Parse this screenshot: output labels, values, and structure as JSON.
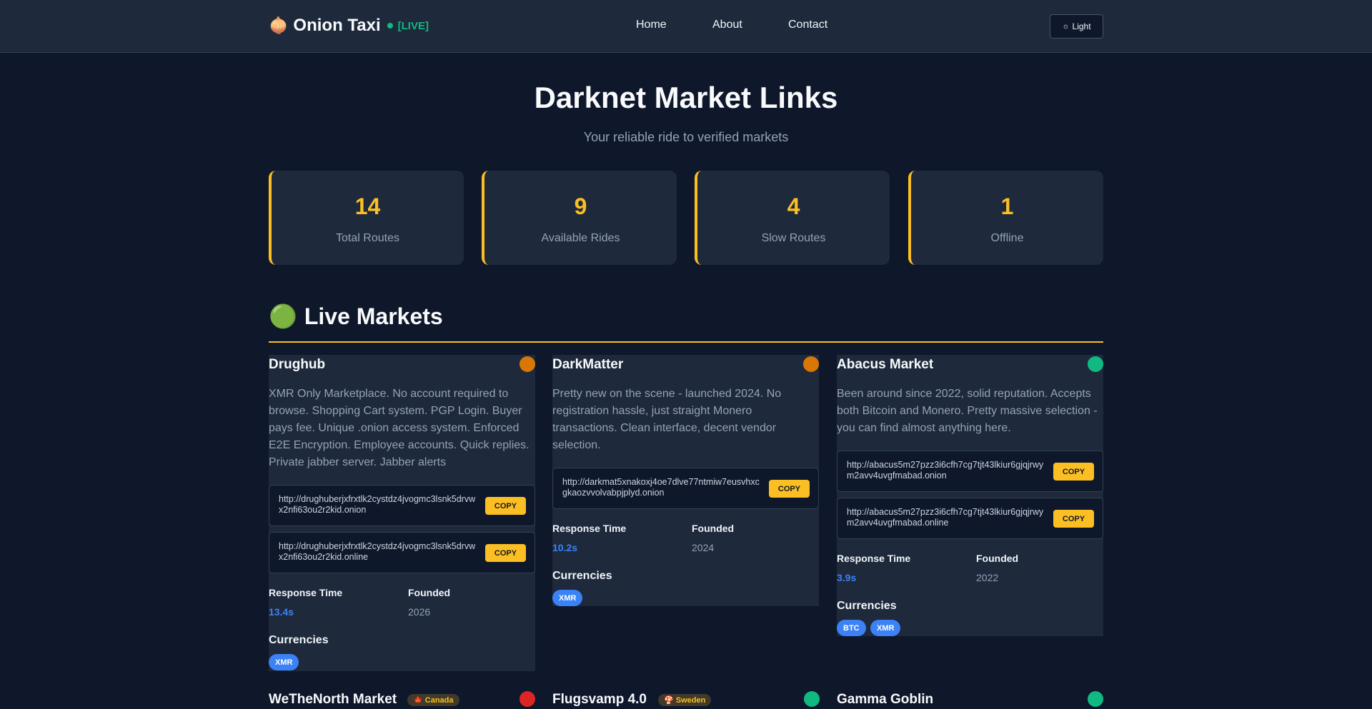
{
  "nav": {
    "brand_icon": "🧅",
    "brand_name": "Onion Taxi",
    "live_text": "[LIVE]",
    "links": [
      "Home",
      "About",
      "Contact"
    ],
    "theme_icon": "☼",
    "theme_label": "Light"
  },
  "hero": {
    "title": "Darknet Market Links",
    "subtitle": "Your reliable ride to verified markets"
  },
  "stats": [
    {
      "value": "14",
      "label": "Total Routes"
    },
    {
      "value": "9",
      "label": "Available Rides"
    },
    {
      "value": "4",
      "label": "Slow Routes"
    },
    {
      "value": "1",
      "label": "Offline"
    }
  ],
  "section": {
    "icon": "🟢",
    "title": "Live Markets"
  },
  "labels": {
    "copy": "COPY",
    "response_time": "Response Time",
    "founded": "Founded",
    "currencies": "Currencies"
  },
  "colors": {
    "accent": "#fbbf24",
    "status_slow": "#d97706",
    "status_online": "#10b981",
    "status_offline": "#dc2626",
    "link": "#3b82f6"
  },
  "markets": [
    {
      "name": "Drughub",
      "status": "slow",
      "description": "XMR Only Marketplace. No account required to browse. Shopping Cart system. PGP Login. Buyer pays fee. Unique .onion access system. Enforced E2E Encryption. Employee accounts. Quick replies. Private jabber server. Jabber alerts",
      "links": [
        "http://drughuberjxfrxtlk2cystdz4jvogmc3lsnk5drvwx2nfi63ou2r2kid.onion",
        "http://drughuberjxfrxtlk2cystdz4jvogmc3lsnk5drvwx2nfi63ou2r2kid.online"
      ],
      "response_time": "13.4s",
      "founded": "2026",
      "currencies": [
        "XMR"
      ]
    },
    {
      "name": "DarkMatter",
      "status": "slow",
      "description": "Pretty new on the scene - launched 2024. No registration hassle, just straight Monero transactions. Clean interface, decent vendor selection.",
      "links": [
        "http://darkmat5xnakoxj4oe7dlve77ntmiw7eusvhxcgkaozvvolvabpjplyd.onion"
      ],
      "response_time": "10.2s",
      "founded": "2024",
      "currencies": [
        "XMR"
      ]
    },
    {
      "name": "Abacus Market",
      "status": "online",
      "description": "Been around since 2022, solid reputation. Accepts both Bitcoin and Monero. Pretty massive selection - you can find almost anything here.",
      "links": [
        "http://abacus5m27pzz3i6cfh7cg7tjt43lkiur6gjqjrwym2avv4uvgfmabad.onion",
        "http://abacus5m27pzz3i6cfh7cg7tjt43lkiur6gjqjrwym2avv4uvgfmabad.online"
      ],
      "response_time": "3.9s",
      "founded": "2022",
      "currencies": [
        "BTC",
        "XMR"
      ]
    }
  ],
  "next_row": [
    {
      "name": "WeTheNorth Market",
      "country_icon": "🍁",
      "country": "Canada",
      "status": "offline"
    },
    {
      "name": "Flugsvamp 4.0",
      "country_icon": "🍄",
      "country": "Sweden",
      "status": "online"
    },
    {
      "name": "Gamma Goblin",
      "country_icon": "",
      "country": "",
      "status": "online"
    }
  ]
}
